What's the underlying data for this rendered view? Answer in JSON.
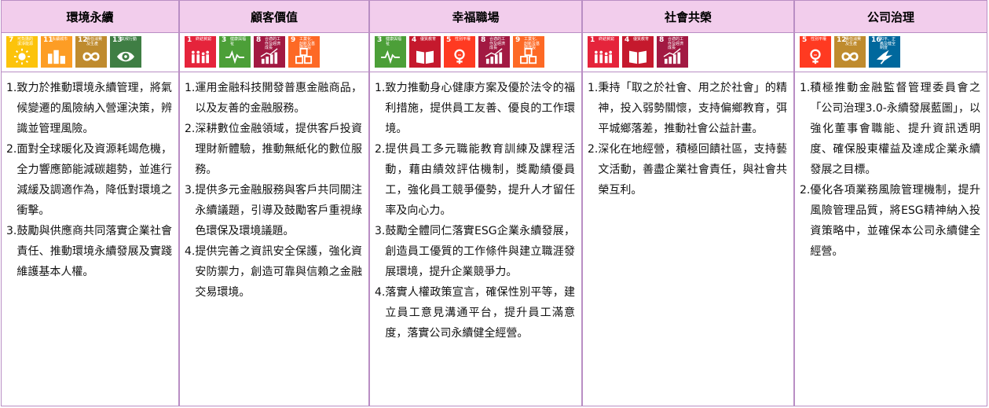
{
  "columns": [
    {
      "title": "環境永續",
      "icons": [
        {
          "num": "7",
          "label": "可負擔的潔淨能源",
          "color": "#FCC30B",
          "icon": "sun-icon"
        },
        {
          "num": "11",
          "label": "永續城市",
          "color": "#FD9D24",
          "icon": "city-icon"
        },
        {
          "num": "12",
          "label": "責任消費及生產",
          "color": "#BF8B2E",
          "icon": "infinity-icon"
        },
        {
          "num": "13",
          "label": "氣候行動",
          "color": "#3F7E44",
          "icon": "eye-globe-icon"
        }
      ],
      "items": [
        {
          "n": "1.",
          "text": "致力於推動環境永續管理，將氣候變遷的風險納入營運決策，辨識並管理風險。"
        },
        {
          "n": "2.",
          "text": "面對全球暖化及資源耗竭危機，全力響應節能減碳趨勢，並進行減緩及調適作為，降低對環境之衝擊。"
        },
        {
          "n": "3.",
          "text": "鼓勵與供應商共同落實企業社會責任、推動環境永續發展及實踐維護基本人權。"
        }
      ]
    },
    {
      "title": "顧客價值",
      "icons": [
        {
          "num": "1",
          "label": "終結貧窮",
          "color": "#E5243B",
          "icon": "people-icon"
        },
        {
          "num": "3",
          "label": "健康與福祉",
          "color": "#4C9F38",
          "icon": "heartbeat-icon"
        },
        {
          "num": "8",
          "label": "合適的工作及經濟成長",
          "color": "#A21942",
          "icon": "growth-chart-icon"
        },
        {
          "num": "9",
          "label": "工業化、創新及基礎建設",
          "color": "#FD6925",
          "icon": "cubes-icon"
        }
      ],
      "items": [
        {
          "n": "1.",
          "text": "運用金融科技開發普惠金融商品，以及友善的金融服務。"
        },
        {
          "n": "2.",
          "text": "深耕數位金融領域，提供客戶投資理財新體驗，推動無紙化的數位服務。"
        },
        {
          "n": "3.",
          "text": "提供多元金融服務與客戶共同關注永續議題，引導及鼓勵客戶重視綠色環保及環境議題。"
        },
        {
          "n": "4.",
          "text": "提供完善之資訊安全保護，強化資安防禦力，創造可靠與信賴之金融交易環境。"
        }
      ]
    },
    {
      "title": "幸福職場",
      "icons": [
        {
          "num": "3",
          "label": "健康與福祉",
          "color": "#4C9F38",
          "icon": "heartbeat-icon"
        },
        {
          "num": "4",
          "label": "優質教育",
          "color": "#C5192D",
          "icon": "book-icon"
        },
        {
          "num": "5",
          "label": "性別平權",
          "color": "#FF3A21",
          "icon": "gender-icon"
        },
        {
          "num": "8",
          "label": "合適的工作及經濟成長",
          "color": "#A21942",
          "icon": "growth-chart-icon"
        },
        {
          "num": "9",
          "label": "工業化、創新及基礎建設",
          "color": "#FD6925",
          "icon": "cubes-icon"
        }
      ],
      "items": [
        {
          "n": "1.",
          "text": "致力推動身心健康方案及優於法令的福利措施，提供員工友善、優良的工作環境。"
        },
        {
          "n": "2.",
          "text": "提供員工多元職能教育訓練及課程活動，藉由績效評估機制，獎勵績優員工，強化員工競爭優勢，提升人才留任率及向心力。"
        },
        {
          "n": "3.",
          "text": "鼓勵全體同仁落實ESG企業永續發展，創造員工優質的工作條件與建立職涯發展環境，提升企業競爭力。"
        },
        {
          "n": "4.",
          "text": "落實人權政策宣言，確保性別平等，建立員工意見溝通平台，提升員工滿意度，落實公司永續健全經營。"
        }
      ]
    },
    {
      "title": "社會共榮",
      "icons": [
        {
          "num": "1",
          "label": "終結貧窮",
          "color": "#E5243B",
          "icon": "people-icon"
        },
        {
          "num": "4",
          "label": "優質教育",
          "color": "#C5192D",
          "icon": "book-icon"
        },
        {
          "num": "8",
          "label": "合適的工作及經濟成長",
          "color": "#A21942",
          "icon": "growth-chart-icon"
        }
      ],
      "items": [
        {
          "n": "1.",
          "text": "秉持「取之於社會、用之於社會」的精神，投入弱勢關懷，支持偏鄉教育，弭平城鄉落差，推動社會公益計畫。"
        },
        {
          "n": "2.",
          "text": "深化在地經營，積極回饋社區，支持藝文活動，善盡企業社會責任，與社會共榮互利。"
        }
      ]
    },
    {
      "title": "公司治理",
      "icons": [
        {
          "num": "5",
          "label": "性別平權",
          "color": "#FF3A21",
          "icon": "gender-icon"
        },
        {
          "num": "12",
          "label": "責任消費及生產",
          "color": "#BF8B2E",
          "icon": "infinity-icon"
        },
        {
          "num": "16",
          "label": "和平、正義及健全制度",
          "color": "#00689D",
          "icon": "dove-icon"
        }
      ],
      "items": [
        {
          "n": "1.",
          "text": "積極推動金融監督管理委員會之「公司治理3.0-永續發展藍圖」，以強化董事會職能、提升資訊透明度、確保股東權益及達成企業永續發展之目標。"
        },
        {
          "n": "2.",
          "text": "優化各項業務風險管理機制，提升風險管理品質，將ESG精神納入投資策略中，並確保本公司永續健全經營。"
        }
      ]
    }
  ]
}
